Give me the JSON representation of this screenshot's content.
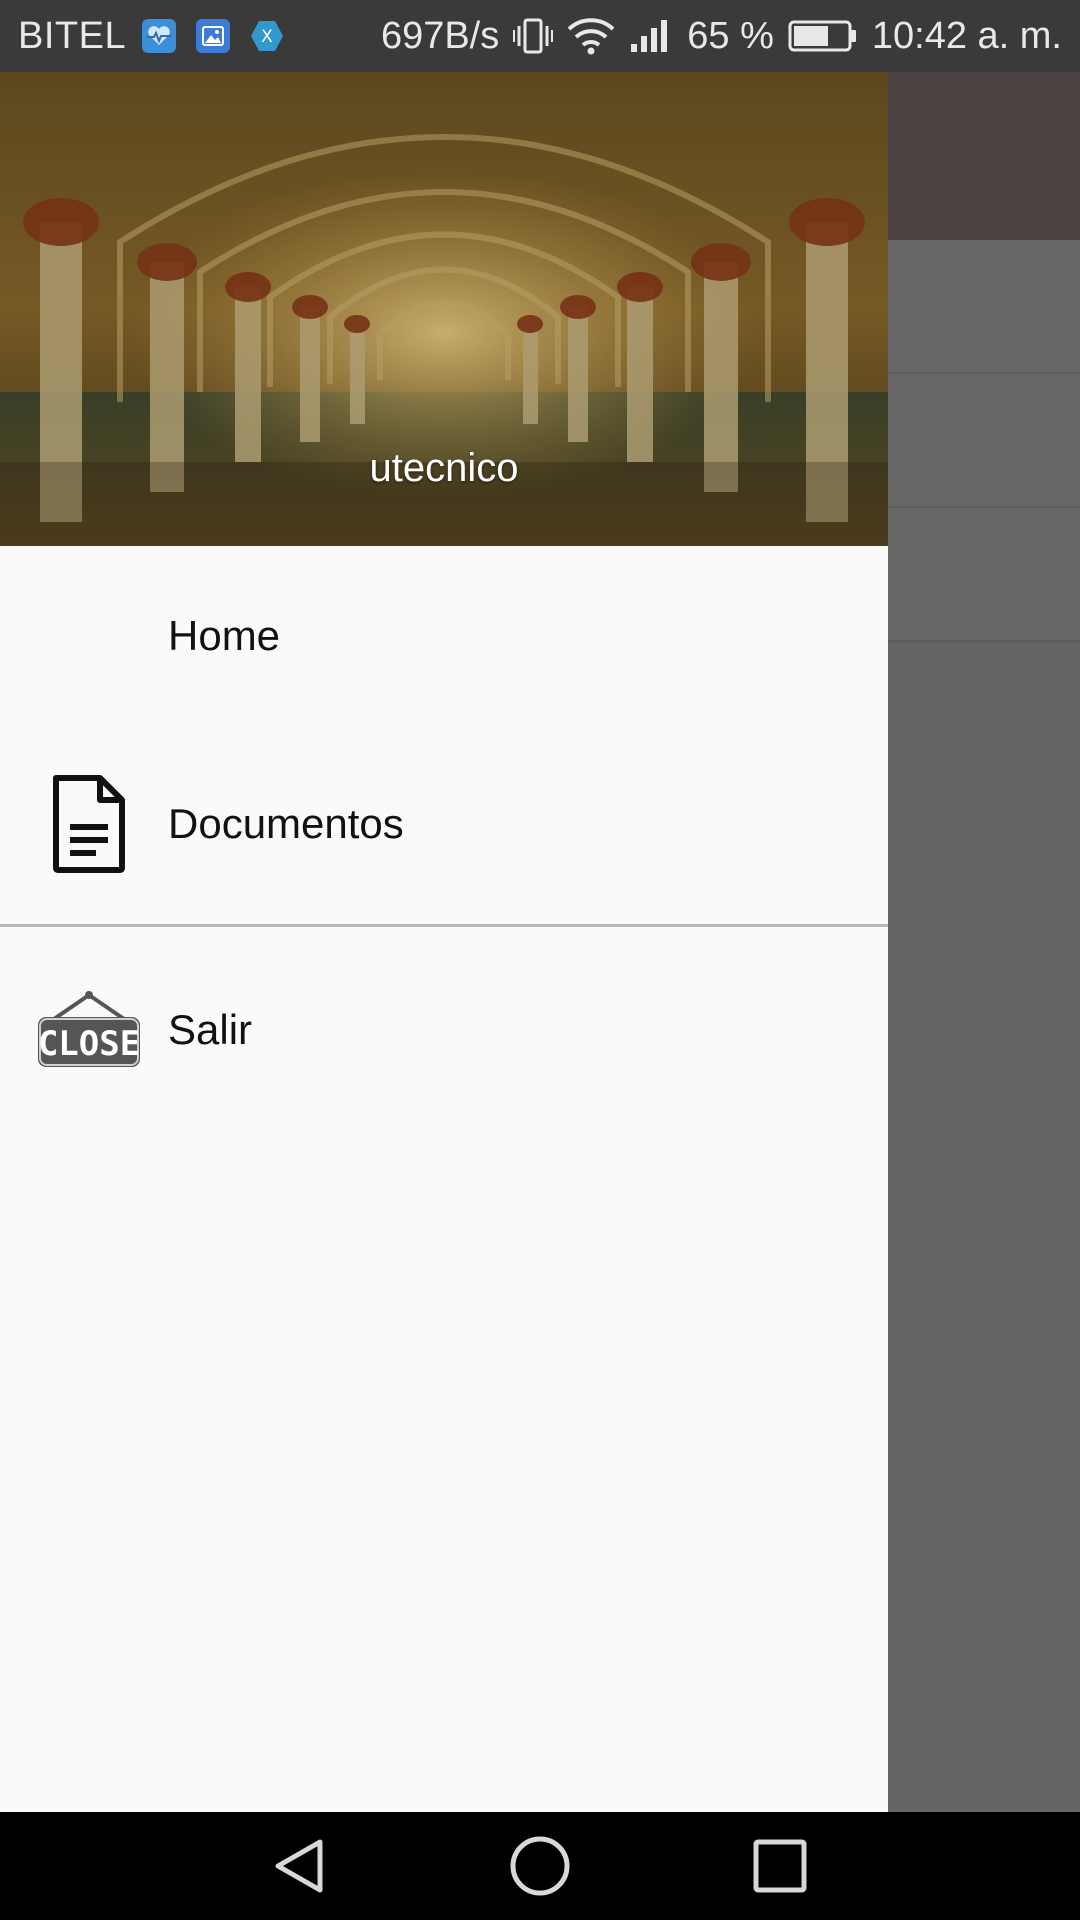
{
  "status_bar": {
    "carrier": "BITEL",
    "network_speed": "697B/s",
    "battery_percent": "65 %",
    "time": "10:42 a. m.",
    "notification_icons": [
      "health-app-icon",
      "gallery-app-icon",
      "xamarin-app-icon"
    ],
    "system_icons": [
      "vibrate-icon",
      "wifi-icon",
      "signal-icon",
      "battery-icon"
    ],
    "battery_level": 0.65
  },
  "drawer": {
    "header": {
      "username": "utecnico"
    },
    "items": [
      {
        "label": "Home",
        "icon": "none"
      },
      {
        "label": "Documentos",
        "icon": "document-icon"
      },
      {
        "label": "Salir",
        "icon": "close-sign-icon",
        "icon_text": "CLOSE"
      }
    ]
  },
  "nav_bar": {
    "buttons": [
      "back-button",
      "home-button",
      "recents-button"
    ]
  },
  "colors": {
    "drawer_bg": "#fafafa",
    "scrim": "#656565",
    "status_bar": "#3a3a3a",
    "nav_bar": "#000000",
    "text": "#111111"
  }
}
